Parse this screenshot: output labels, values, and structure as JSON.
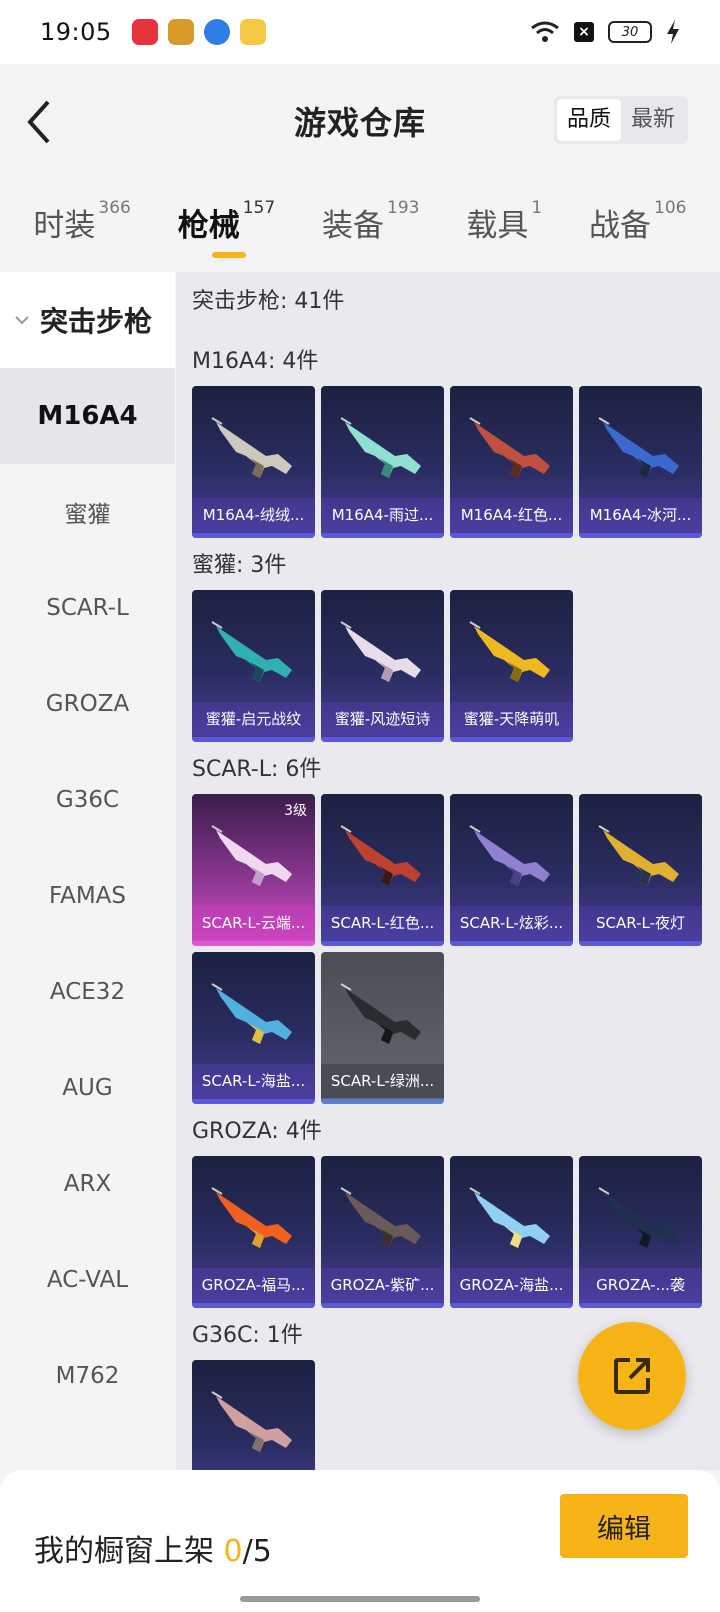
{
  "status_bar": {
    "time": "19:05",
    "battery": "30"
  },
  "header": {
    "title": "游戏仓库",
    "sort_options": [
      "品质",
      "最新"
    ],
    "active_sort": "品质"
  },
  "tabs": [
    {
      "label": "时装",
      "count": "366"
    },
    {
      "label": "枪械",
      "count": "157",
      "active": true
    },
    {
      "label": "装备",
      "count": "193"
    },
    {
      "label": "载具",
      "count": "1"
    },
    {
      "label": "战备",
      "count": "106"
    }
  ],
  "sidebar": {
    "group": "突击步枪",
    "items": [
      "M16A4",
      "蜜獾",
      "SCAR-L",
      "GROZA",
      "G36C",
      "FAMAS",
      "ACE32",
      "AUG",
      "ARX",
      "AC-VAL",
      "M762"
    ],
    "active_item": "M16A4"
  },
  "content": {
    "total": "突击步枪: 41件",
    "sections": [
      {
        "title": "M16A4: 4件",
        "items": [
          {
            "name": "M16A4-绒绒..."
          },
          {
            "name": "M16A4-雨过..."
          },
          {
            "name": "M16A4-红色..."
          },
          {
            "name": "M16A4-冰河..."
          }
        ]
      },
      {
        "title": "蜜獾: 3件",
        "items": [
          {
            "name": "蜜獾-启元战纹"
          },
          {
            "name": "蜜獾-风迹短诗"
          },
          {
            "name": "蜜獾-天降萌叽"
          }
        ]
      },
      {
        "title": "SCAR-L: 6件",
        "items": [
          {
            "name": "SCAR-L-云端...",
            "level": "3级",
            "rarity": "pink"
          },
          {
            "name": "SCAR-L-红色..."
          },
          {
            "name": "SCAR-L-炫彩..."
          },
          {
            "name": "SCAR-L-夜灯"
          },
          {
            "name": "SCAR-L-海盐..."
          },
          {
            "name": "SCAR-L-绿洲...",
            "rarity": "gray"
          }
        ]
      },
      {
        "title": "GROZA: 4件",
        "items": [
          {
            "name": "GROZA-福马..."
          },
          {
            "name": "GROZA-紫矿..."
          },
          {
            "name": "GROZA-海盐..."
          },
          {
            "name": "GROZA-...袭"
          }
        ]
      },
      {
        "title": "G36C: 1件",
        "items": [
          {
            "name": ""
          }
        ]
      }
    ]
  },
  "bottom_bar": {
    "shelf_label": "我的橱窗上架 ",
    "shelf_current": "0",
    "shelf_total": "/5",
    "edit_label": "编辑"
  },
  "colors": {
    "accent": "#f7b418",
    "card_purple": "#2a2d60",
    "card_pink": "#d64ec8",
    "card_gray": "#5a5d66"
  },
  "icons": {
    "back": "chevron-left-icon",
    "share": "share-icon"
  }
}
